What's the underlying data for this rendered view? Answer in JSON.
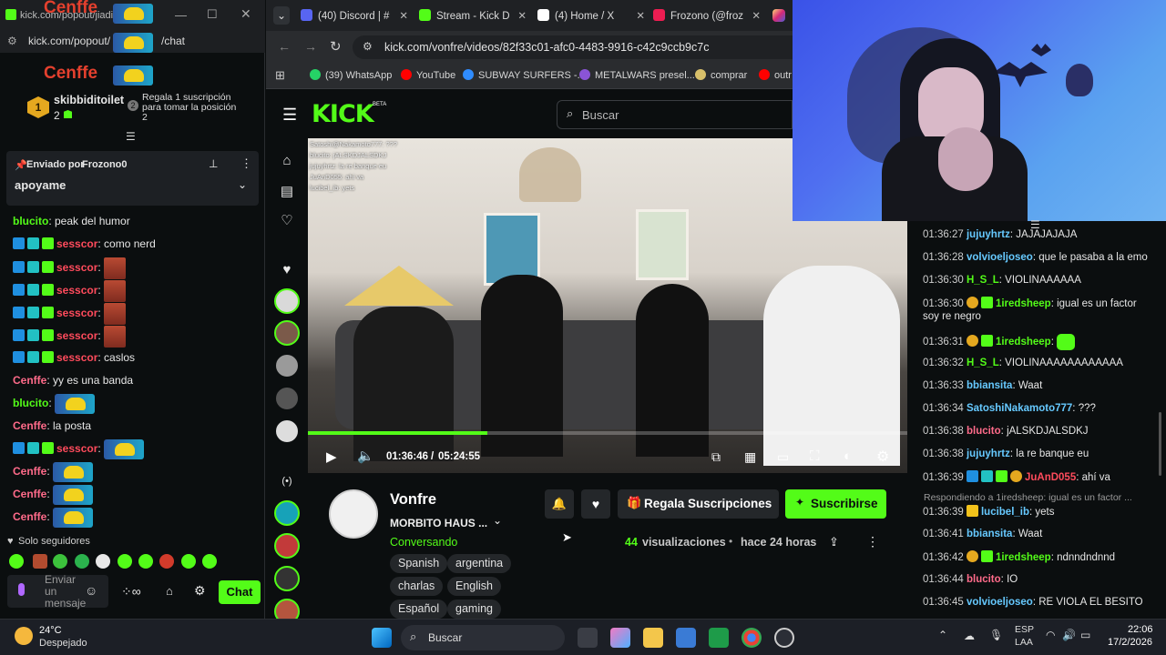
{
  "popout": {
    "url_tab": "kick.com/popout/jiadil...",
    "url": "kick.com/popout/",
    "url_suffix": "/chat",
    "overlay_name": "Cenffe",
    "leader": {
      "name": "skibbiditoilet",
      "count": "2",
      "rank": "1",
      "hint": "Regala 1 suscripción para tomar la posición 2"
    },
    "pinned": {
      "label": "Enviado por",
      "author": "Frozono0",
      "text": "apoyame"
    },
    "messages": [
      {
        "user": "blucito",
        "sep": ": ",
        "text": "peak del humor",
        "cls": "u-green",
        "badges": false,
        "emote": "none"
      },
      {
        "user": "sesscor",
        "sep": ": ",
        "text": "como nerd",
        "cls": "u-red",
        "badges": true,
        "emote": "none"
      },
      {
        "user": "sesscor",
        "sep": ": ",
        "text": "",
        "cls": "u-red",
        "badges": true,
        "emote": "meat"
      },
      {
        "user": "sesscor",
        "sep": ": ",
        "text": "",
        "cls": "u-red",
        "badges": true,
        "emote": "meat"
      },
      {
        "user": "sesscor",
        "sep": ": ",
        "text": "",
        "cls": "u-red",
        "badges": true,
        "emote": "meat"
      },
      {
        "user": "sesscor",
        "sep": ": ",
        "text": "",
        "cls": "u-red",
        "badges": true,
        "emote": "meat"
      },
      {
        "user": "sesscor",
        "sep": ": ",
        "text": "caslos",
        "cls": "u-red",
        "badges": true,
        "emote": "none"
      },
      {
        "user": "Cenffe",
        "sep": ": ",
        "text": "yy es una banda",
        "cls": "u-pink",
        "badges": false,
        "emote": "none"
      },
      {
        "user": "blucito",
        "sep": ": ",
        "text": "",
        "cls": "u-green",
        "badges": false,
        "emote": "car"
      },
      {
        "user": "Cenffe",
        "sep": ": ",
        "text": "la posta",
        "cls": "u-pink",
        "badges": false,
        "emote": "none"
      },
      {
        "user": "sesscor",
        "sep": ": ",
        "text": "",
        "cls": "u-red",
        "badges": true,
        "emote": "car"
      },
      {
        "user": "Cenffe",
        "sep": ": ",
        "text": "",
        "cls": "u-pink",
        "badges": false,
        "emote": "car"
      },
      {
        "user": "Cenffe",
        "sep": ": ",
        "text": "",
        "cls": "u-pink",
        "badges": false,
        "emote": "car"
      },
      {
        "user": "Cenffe",
        "sep": ": ",
        "text": "",
        "cls": "u-pink",
        "badges": false,
        "emote": "car"
      }
    ],
    "followers_only": "Solo seguidores",
    "input_placeholder": "Enviar un mensaje",
    "chat_button": "Chat"
  },
  "browser": {
    "tabs": [
      {
        "label": "(40) Discord | #",
        "color": "#5865f2"
      },
      {
        "label": "Stream - Kick D",
        "color": "#53fc18"
      },
      {
        "label": "(4) Home / X",
        "color": "#ffffff"
      },
      {
        "label": "Frozono (@froz",
        "color": "#ee1d52"
      }
    ],
    "url": "kick.com/vonfre/videos/82f33c01-afc0-4483-9916-c42c9ccb9c7c",
    "bookmarks": [
      {
        "label": "(39) WhatsApp",
        "color": "#25d366"
      },
      {
        "label": "YouTube",
        "color": "#ff0000"
      },
      {
        "label": "SUBWAY SURFERS -...",
        "color": "#2f8cff"
      },
      {
        "label": "METALWARS presel...",
        "color": "#8a54d6"
      },
      {
        "label": "comprar",
        "color": "#d8c06a"
      },
      {
        "label": "outr",
        "color": "#ff0000"
      }
    ]
  },
  "kick": {
    "logo": "KICK",
    "logo_beta": "BETA",
    "search_placeholder": "Buscar",
    "video_overlay": [
      "Satoshi@Nakamoto777: ???",
      "blucito: jALSKDJALSDKJ",
      "jujuyhrtz: la re banque eu",
      "JuAnD055: ahi va",
      "lucibel_ib: yets"
    ],
    "time_current": "01:36:46",
    "time_total": "05:24:55",
    "progress": 0.3,
    "channel": "Vonfre",
    "title": "MORBITO HAUS ...",
    "category": "Conversando",
    "tags": [
      "Spanish",
      "argentina",
      "charlas",
      "English",
      "Español",
      "gaming"
    ],
    "views_count": "44",
    "views_label": "visualizaciones",
    "age": "hace 24 horas",
    "gift_button": "Regala Suscripciones",
    "subscribe_button": "Suscribirse"
  },
  "right_chat": {
    "messages": [
      {
        "ts": "01:36:27",
        "user": "jujuyhrtz",
        "text": "JAJAJAJAJA",
        "cls": "u-blue"
      },
      {
        "ts": "01:36:28",
        "user": "volvioeljoseo",
        "text": "que le pasaba a la emo",
        "cls": "u-blue"
      },
      {
        "ts": "01:36:30",
        "user": "H_S_L",
        "text": "VIOLINAAAAAA",
        "cls": "u-green"
      },
      {
        "ts": "01:36:30",
        "user": "1iredsheep",
        "text": "igual es un factor soy re negro",
        "cls": "u-green"
      },
      {
        "ts": "01:36:31",
        "user": "1iredsheep",
        "text": "",
        "cls": "u-green"
      },
      {
        "ts": "01:36:32",
        "user": "H_S_L",
        "text": "VIOLINAAAAAAAAAAAA",
        "cls": "u-green"
      },
      {
        "ts": "01:36:33",
        "user": "bbiansita",
        "text": "Waat",
        "cls": "u-blue"
      },
      {
        "ts": "01:36:34",
        "user": "SatoshiNakamoto777",
        "text": "???",
        "cls": "u-blue"
      },
      {
        "ts": "01:36:38",
        "user": "blucito",
        "text": "jALSKDJALSDKJ",
        "cls": "u-pink"
      },
      {
        "ts": "01:36:38",
        "user": "jujuyhrtz",
        "text": "la re banque eu",
        "cls": "u-blue"
      },
      {
        "ts": "01:36:39",
        "user": "JuAnD055",
        "text": "ahí va",
        "cls": "u-red"
      },
      {
        "ts": "01:36:39",
        "user": "lucibel_ib",
        "text": "yets",
        "cls": "u-blue"
      },
      {
        "ts": "01:36:41",
        "user": "bbiansita",
        "text": "Waat",
        "cls": "u-blue"
      },
      {
        "ts": "01:36:42",
        "user": "1iredsheep",
        "text": "ndnndndnnd",
        "cls": "u-green"
      },
      {
        "ts": "01:36:44",
        "user": "blucito",
        "text": "IO",
        "cls": "u-pink"
      },
      {
        "ts": "01:36:45",
        "user": "volvioeljoseo",
        "text": "RE VIOLA EL BESITO",
        "cls": "u-blue"
      }
    ],
    "reply_hint": "Respondiendo a 1iredsheep: igual es un factor ..."
  },
  "taskbar": {
    "weather_temp": "24°C",
    "weather_desc": "Despejado",
    "search": "Buscar",
    "lang1": "ESP",
    "lang2": "LAA",
    "time": "22:06",
    "date": "17/2/2026"
  }
}
